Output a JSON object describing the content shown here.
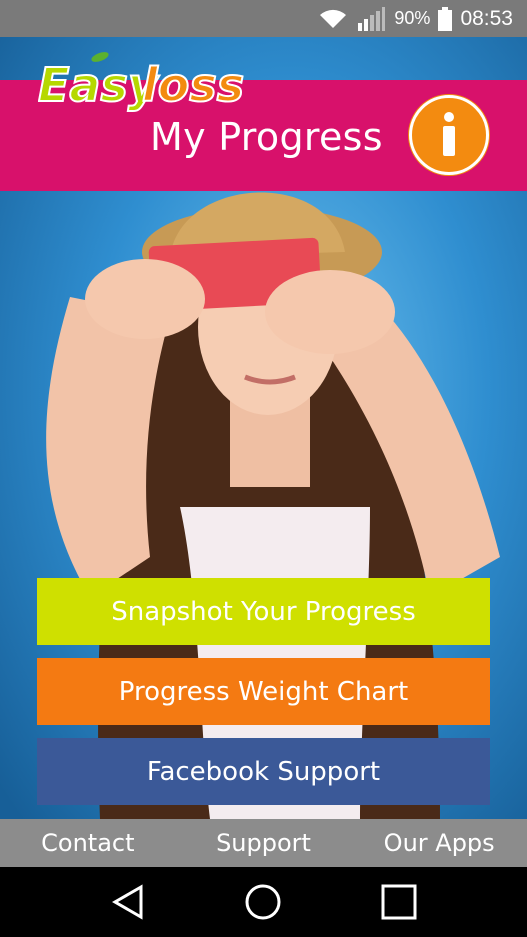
{
  "status_bar": {
    "battery_percent": "90%",
    "time": "08:53",
    "icons": [
      "wifi-icon",
      "signal-icon",
      "battery-icon"
    ]
  },
  "header": {
    "logo_text": "EasyLoss",
    "title": "My Progress",
    "info_icon": "info-icon"
  },
  "actions": {
    "snapshot_label": "Snapshot Your Progress",
    "chart_label": "Progress Weight Chart",
    "facebook_label": "Facebook Support"
  },
  "tabs": {
    "contact": "Contact",
    "support": "Support",
    "apps": "Our Apps"
  },
  "nav": {
    "icons": [
      "back-icon",
      "home-icon",
      "recents-icon"
    ]
  },
  "colors": {
    "header": "#d8116b",
    "snapshot": "#cfe000",
    "chart": "#f47a12",
    "facebook": "#3b5998",
    "tab_bar": "#8c8c8c",
    "info": "#f38b10"
  }
}
